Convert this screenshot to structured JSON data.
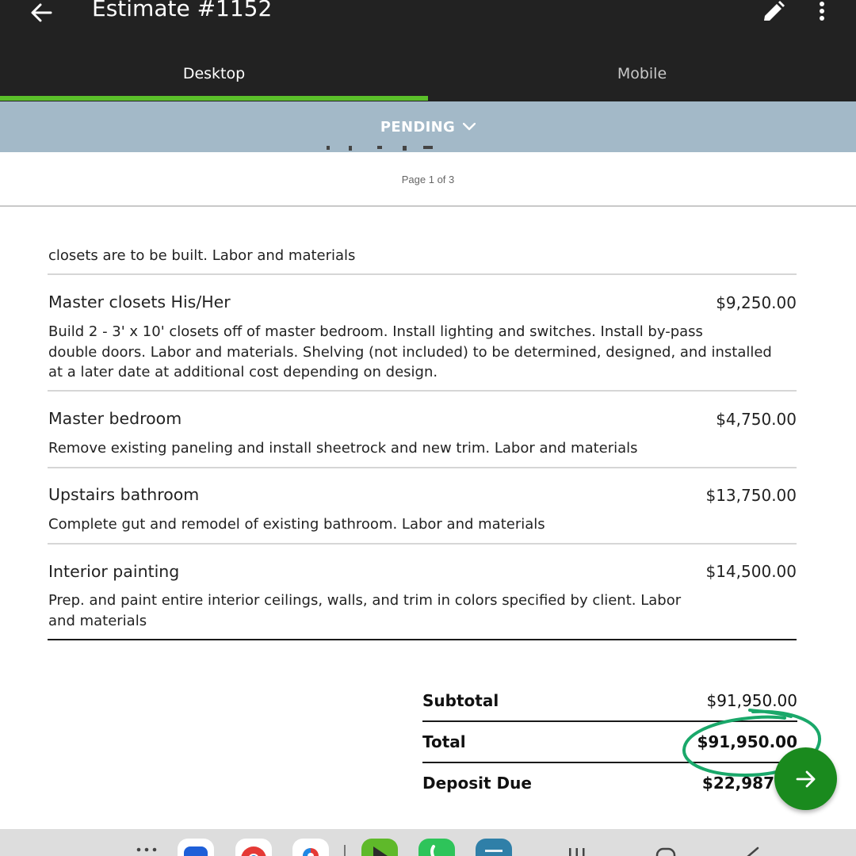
{
  "app_bar": {
    "title": "Estimate #1152",
    "back_icon": "arrow-left-icon",
    "edit_icon": "pencil-icon",
    "more_icon": "more-vert-icon"
  },
  "tabs": [
    {
      "label": "Desktop",
      "active": true
    },
    {
      "label": "Mobile",
      "active": false
    }
  ],
  "status": {
    "label": "PENDING",
    "icon": "chevron-down-icon"
  },
  "document": {
    "page_indicator": "Page 1 of 3",
    "continued_text": "closets are to be built. Labor and materials",
    "line_items": [
      {
        "name": "Master closets His/Her",
        "price": "$9,250.00",
        "description_lines": [
          "Build 2 -  3' x 10' closets off of master bedroom. Install lighting and switches. Install by-pass",
          "double doors. Labor and materials. Shelving (not included) to be determined, designed, and installed",
          "at a later date at additional cost depending on design."
        ]
      },
      {
        "name": "Master bedroom",
        "price": "$4,750.00",
        "description_lines": [
          "Remove existing paneling and install sheetrock and new trim. Labor and materials"
        ]
      },
      {
        "name": "Upstairs bathroom",
        "price": "$13,750.00",
        "description_lines": [
          "Complete gut and remodel of existing bathroom. Labor and materials"
        ]
      },
      {
        "name": "Interior painting",
        "price": "$14,500.00",
        "description_lines": [
          "Prep. and paint entire interior ceilings, walls, and trim in colors specified by client. Labor",
          "and materials"
        ]
      }
    ],
    "totals": {
      "subtotal_label": "Subtotal",
      "subtotal_value": "$91,950.00",
      "total_label": "Total",
      "total_value": "$91,950.00",
      "deposit_label": "Deposit Due",
      "deposit_value": "$22,987"
    }
  },
  "fab": {
    "icon": "arrow-right-icon"
  },
  "dock": {
    "icons": [
      "app-drawer-icon",
      "samsung-app-icon",
      "chrome-icon",
      "google-maps-icon",
      "play-store-icon",
      "phone-icon",
      "merrick-app-icon",
      "recents-nav-icon",
      "home-nav-icon",
      "back-nav-icon"
    ]
  },
  "colors": {
    "app_bar_bg": "#222222",
    "tab_indicator": "#5bbf2a",
    "status_band": "#a3b9c8",
    "fab": "#1a8a1e",
    "highlight_circle": "#1aa86a"
  }
}
